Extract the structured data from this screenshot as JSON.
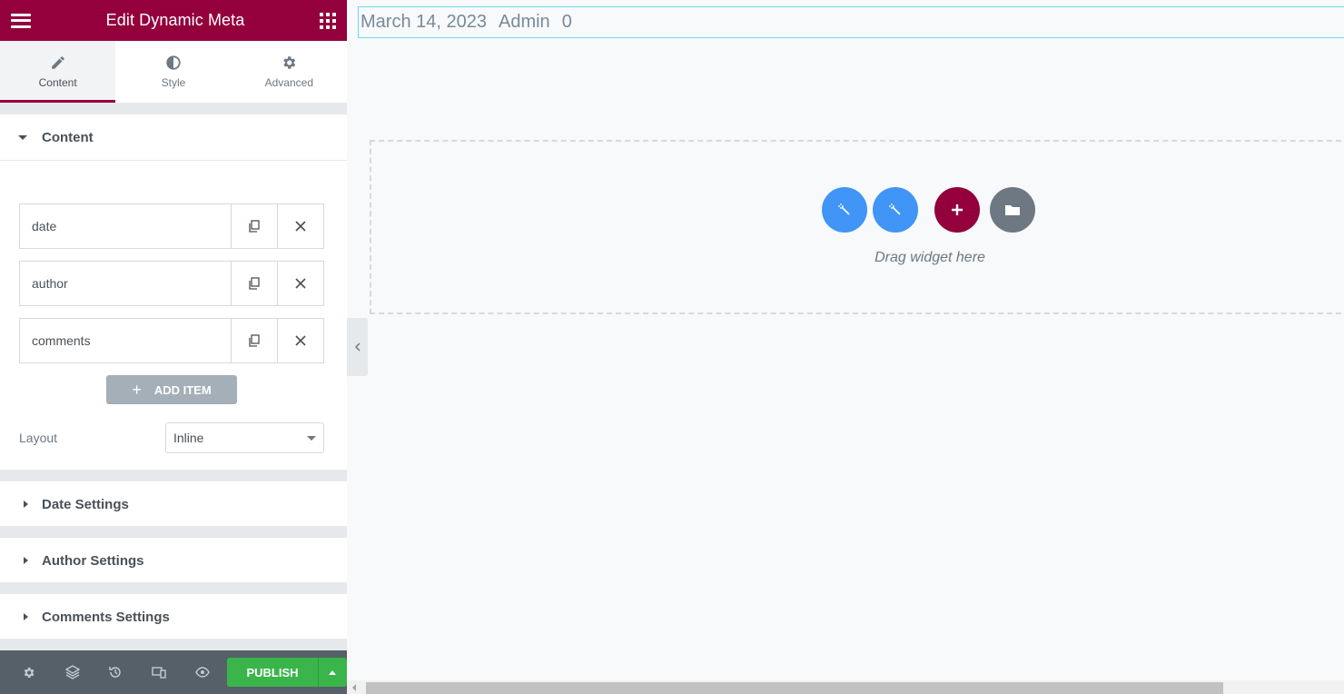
{
  "header": {
    "title": "Edit Dynamic Meta"
  },
  "tabs": [
    {
      "label": "Content",
      "icon": "pencil-icon"
    },
    {
      "label": "Style",
      "icon": "half-circle-icon"
    },
    {
      "label": "Advanced",
      "icon": "gear-icon"
    }
  ],
  "content_section": {
    "title": "Content",
    "items": [
      {
        "label": "date"
      },
      {
        "label": "author"
      },
      {
        "label": "comments"
      }
    ],
    "add_item_label": "ADD ITEM",
    "layout_label": "Layout",
    "layout_value": "Inline"
  },
  "collapsed_sections": [
    {
      "title": "Date Settings"
    },
    {
      "title": "Author Settings"
    },
    {
      "title": "Comments Settings"
    }
  ],
  "footer": {
    "publish_label": "PUBLISH"
  },
  "preview": {
    "meta": [
      "March 14, 2023",
      "Admin",
      "0"
    ],
    "dropzone_text": "Drag widget here"
  },
  "colors": {
    "brand": "#93003c",
    "accent_blue": "#4095f6",
    "publish_green": "#39b54a"
  }
}
